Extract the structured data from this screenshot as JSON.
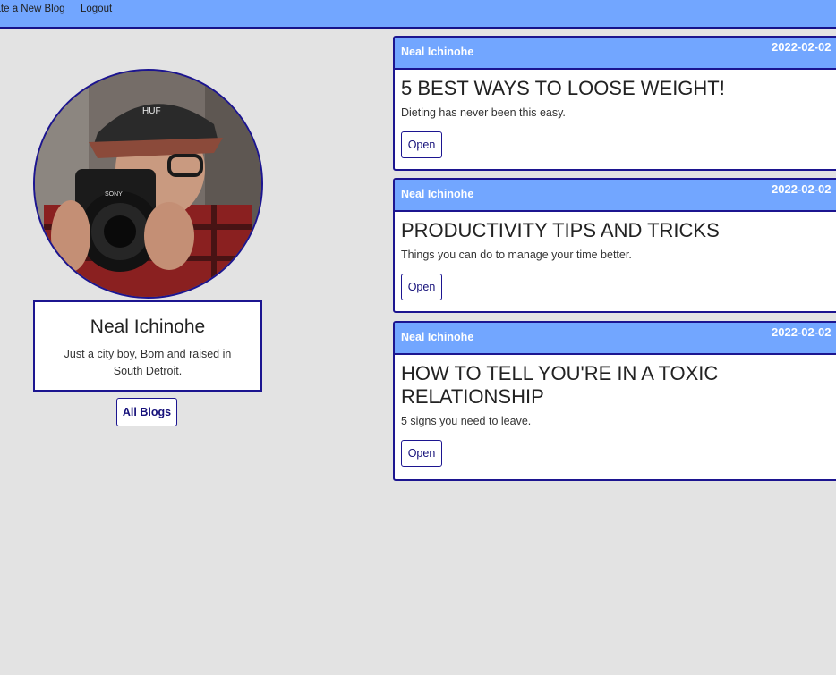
{
  "nav": {
    "create_label": "Create a New Blog",
    "logout_label": "Logout"
  },
  "profile": {
    "name": "Neal Ichinohe",
    "bio": "Just a city boy, Born and raised in South Detroit.",
    "all_blogs_label": "All Blogs"
  },
  "blogs": [
    {
      "author": "Neal Ichinohe",
      "date": "2022-02-02",
      "title": "5 BEST WAYS TO LOOSE WEIGHT!",
      "description": "Dieting has never been this easy.",
      "open_label": "Open"
    },
    {
      "author": "Neal Ichinohe",
      "date": "2022-02-02",
      "title": "PRODUCTIVITY TIPS AND TRICKS",
      "description": "Things you can do to manage your time better.",
      "open_label": "Open"
    },
    {
      "author": "Neal Ichinohe",
      "date": "2022-02-02",
      "title": "HOW TO TELL YOU'RE IN A TOXIC RELATIONSHIP",
      "description": "5 signs you need to leave.",
      "open_label": "Open"
    }
  ],
  "colors": {
    "nav_bg": "#72a6ff",
    "border_accent": "#1c1590",
    "page_bg": "#e3e3e3"
  }
}
